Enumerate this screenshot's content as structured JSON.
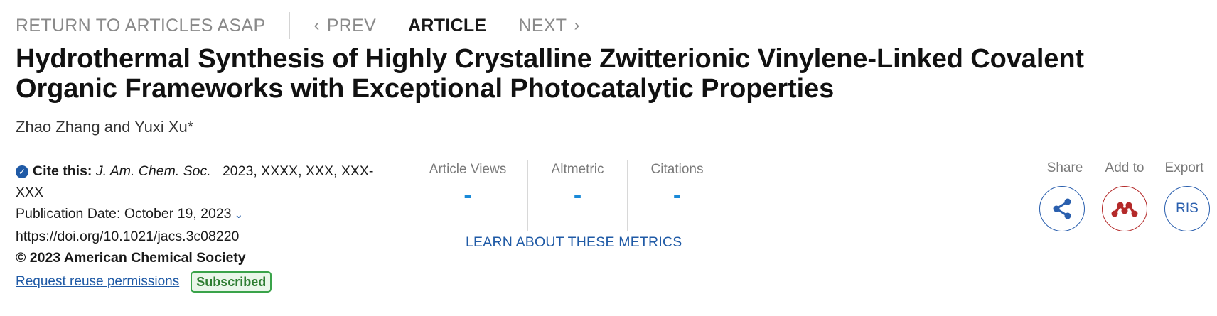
{
  "nav": {
    "return_label": "RETURN TO ARTICLES ASAP",
    "prev_label": "PREV",
    "article_label": "ARTICLE",
    "next_label": "NEXT"
  },
  "article": {
    "title": "Hydrothermal Synthesis of Highly Crystalline Zwitterionic Vinylene-Linked Covalent Organic Frameworks with Exceptional Photocatalytic Properties",
    "authors": "Zhao Zhang and Yuxi Xu*"
  },
  "citation": {
    "cite_label": "Cite this:",
    "journal": "J. Am. Chem. Soc.",
    "details": "2023, XXXX, XXX, XXX-XXX",
    "publication_date": "Publication Date: October 19, 2023",
    "doi": "https://doi.org/10.1021/jacs.3c08220",
    "copyright": "© 2023 American Chemical Society",
    "reuse_link": "Request reuse permissions",
    "access_badge": "Subscribed"
  },
  "metrics": {
    "items": [
      {
        "label": "Article Views",
        "value": "-"
      },
      {
        "label": "Altmetric",
        "value": "-"
      },
      {
        "label": "Citations",
        "value": "-"
      }
    ],
    "learn_link": "LEARN ABOUT THESE METRICS"
  },
  "actions": {
    "share_label": "Share",
    "add_label": "Add to",
    "export_label": "Export",
    "ris_label": "RIS",
    "share_icon": "share-icon",
    "mendeley_icon": "mendeley-icon"
  },
  "colors": {
    "link_blue": "#1f5aa6",
    "metric_blue": "#1a8ad8",
    "mendeley_red": "#b42a2a",
    "subscribed_green": "#3aa34a"
  }
}
